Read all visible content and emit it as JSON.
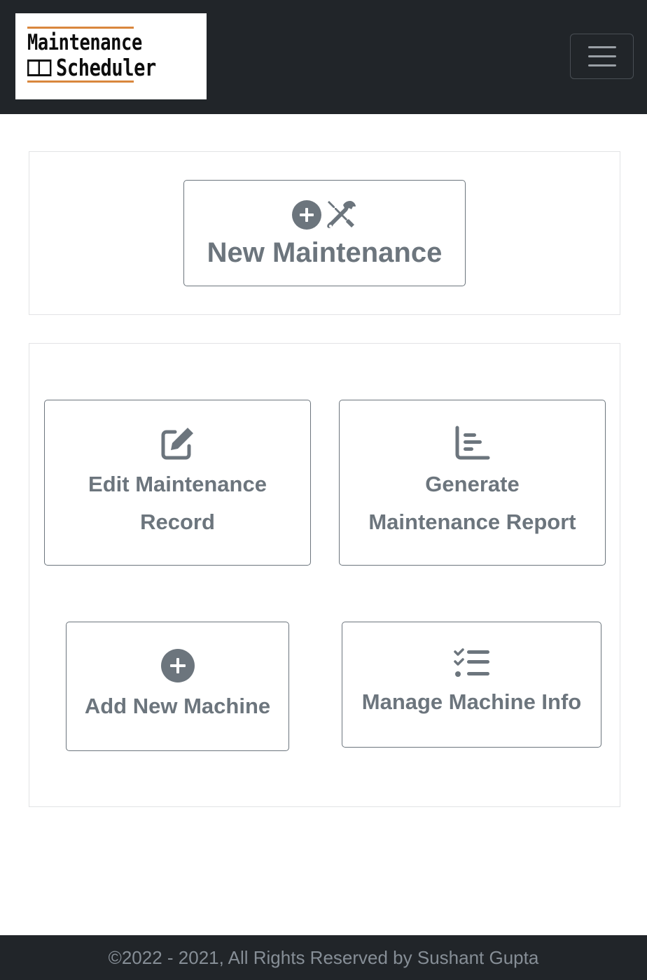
{
  "brand": {
    "line1": "Maintenance",
    "line2": "Scheduler",
    "accent_color": "#d9873d"
  },
  "navbar": {
    "toggler_icon": "hamburger-icon",
    "background": "#212529"
  },
  "actions": {
    "new_maintenance": {
      "label": "New Maintenance",
      "icons": [
        "plus-circle-icon",
        "tools-icon"
      ]
    },
    "edit_record": {
      "label_line1": "Edit Maintenance",
      "label_line2": "Record",
      "icon": "edit-icon"
    },
    "generate_report": {
      "label_line1": "Generate",
      "label_line2": "Maintenance Report",
      "icon": "bar-chart-icon"
    },
    "add_machine": {
      "label": "Add New Machine",
      "icon": "plus-circle-icon"
    },
    "manage_machine": {
      "label": "Manage Machine Info",
      "icon": "list-check-icon"
    }
  },
  "footer": {
    "text": "©2022 - 2021, All Rights Reserved by Sushant Gupta"
  }
}
